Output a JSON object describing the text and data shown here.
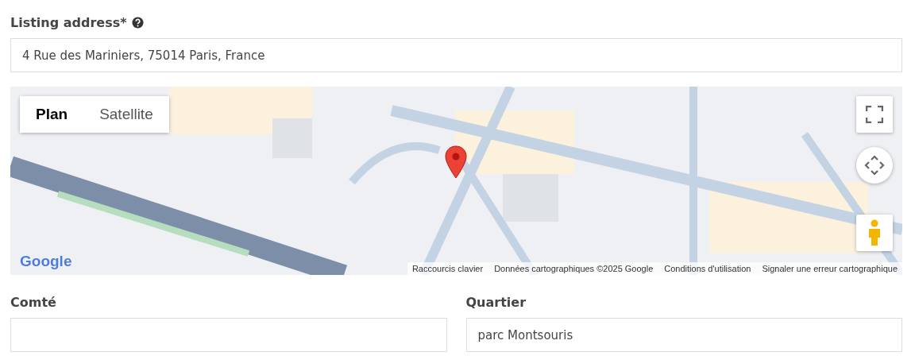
{
  "address": {
    "label": "Listing address*",
    "value": "4 Rue des Mariniers, 75014 Paris, France"
  },
  "map": {
    "kind": "picture",
    "map_types": [
      {
        "label": "Plan",
        "selected": true
      },
      {
        "label": "Satellite",
        "selected": false
      }
    ],
    "logo": "Google",
    "footer": [
      "Raccourcis clavier",
      "Données cartographiques ©2025 Google",
      "Conditions d'utilisation",
      "Signaler une erreur cartographique"
    ]
  },
  "fields": [
    {
      "label": "Comté"
    },
    {
      "label": "Quartier",
      "value": "parc Montsouris"
    }
  ]
}
